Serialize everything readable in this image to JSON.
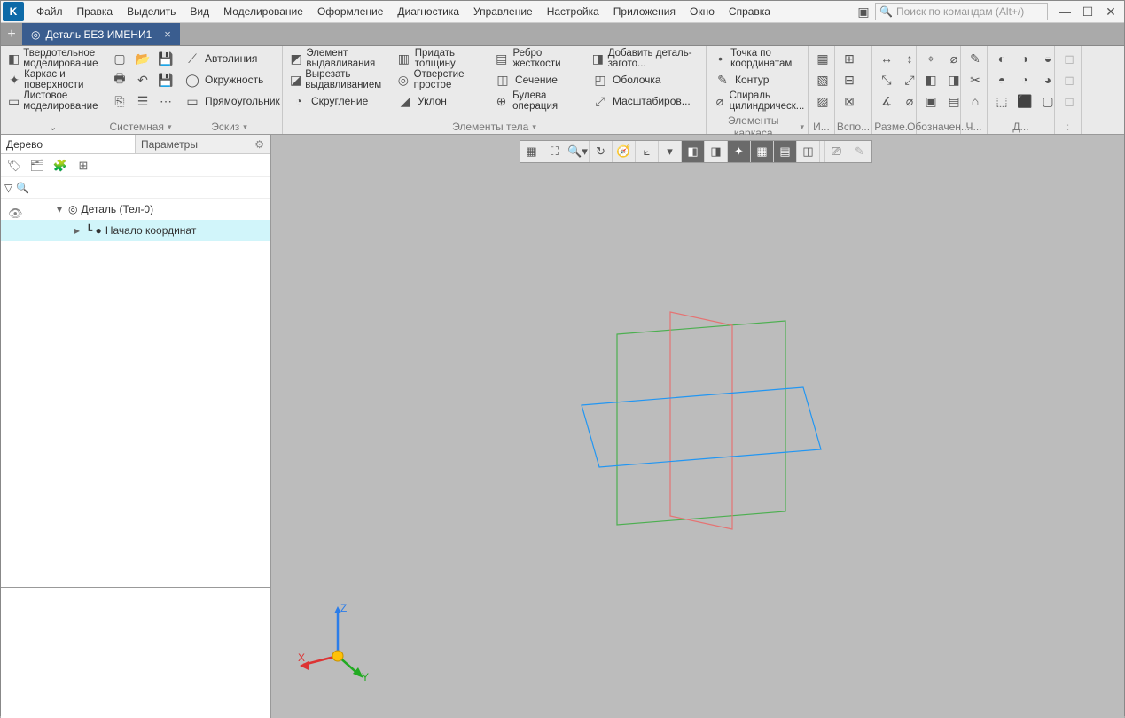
{
  "menubar": {
    "items": [
      "Файл",
      "Правка",
      "Выделить",
      "Вид",
      "Моделирование",
      "Оформление",
      "Диагностика",
      "Управление",
      "Настройка",
      "Приложения",
      "Окно",
      "Справка"
    ],
    "search_placeholder": "Поиск по командам (Alt+/)"
  },
  "tabs": {
    "active": "Деталь БЕЗ ИМЕНИ1"
  },
  "mode_panel": {
    "items": [
      "Твердотельное моделирование",
      "Каркас и поверхности",
      "Листовое моделирование"
    ]
  },
  "ribbon": {
    "sys_label": "Системная",
    "sketch": {
      "label": "Эскиз",
      "items": [
        "Автолиния",
        "Окружность",
        "Прямоугольник"
      ]
    },
    "body": {
      "label": "Элементы тела",
      "col1": [
        "Элемент выдавливания",
        "Вырезать выдавливанием",
        "Скругление"
      ],
      "col2": [
        "Придать толщину",
        "Отверстие простое",
        "Уклон"
      ],
      "col3": [
        "Ребро жесткости",
        "Сечение",
        "Булева операция"
      ],
      "col4": [
        "Добавить деталь-загото...",
        "Оболочка",
        "Масштабиров..."
      ]
    },
    "frame": {
      "label": "Элементы каркаса",
      "items": [
        "Точка по координатам",
        "Контур",
        "Спираль цилиндрическ..."
      ]
    },
    "groups_rest": [
      "И...",
      "Вспо...",
      "Разме...",
      "Обозначен...",
      "Ч...",
      "Д..."
    ]
  },
  "leftpanel": {
    "tabs": [
      "Дерево",
      "Параметры"
    ],
    "tree_root": "Деталь (Тел-0)",
    "tree_child": "Начало координат"
  },
  "axes": {
    "x": "X",
    "y": "Y",
    "z": "Z"
  }
}
